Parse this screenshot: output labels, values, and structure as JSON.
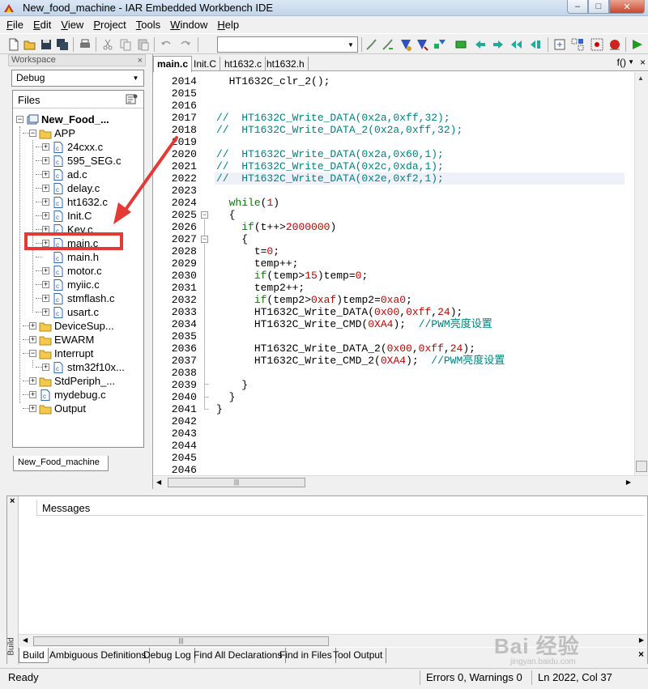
{
  "window": {
    "title": "New_food_machine - IAR Embedded Workbench IDE",
    "buttons": {
      "minimize": "–",
      "maximize": "□",
      "close": "✕"
    }
  },
  "menu": [
    "File",
    "Edit",
    "View",
    "Project",
    "Tools",
    "Window",
    "Help"
  ],
  "workspace": {
    "header": "Workspace",
    "close": "×",
    "config": "Debug",
    "files_label": "Files",
    "bottom_tab": "New_Food_machine",
    "tree": {
      "project": "New_Food_...",
      "app": "APP",
      "app_files": [
        "24cxx.c",
        "595_SEG.c",
        "ad.c",
        "delay.c",
        "ht1632.c",
        "Init.C",
        "Key.c",
        "main.c",
        "main.h",
        "motor.c",
        "myiic.c",
        "stmflash.c",
        "usart.c"
      ],
      "device": "DeviceSup...",
      "ewarm": "EWARM",
      "interrupt": "Interrupt",
      "interrupt_file": "stm32f10x...",
      "stdperiph": "StdPeriph_...",
      "mydebug": "mydebug.c",
      "output": "Output"
    }
  },
  "editor": {
    "tabs": [
      "main.c",
      "Init.C",
      "ht1632.c",
      "ht1632.h"
    ],
    "active_tab": "main.c",
    "func": "f()",
    "close": "×",
    "line_numbers": [
      "2014",
      "2015",
      "2016",
      "2017",
      "2018",
      "2019",
      "2020",
      "2021",
      "2022",
      "2023",
      "2024",
      "2025",
      "2026",
      "2027",
      "2028",
      "2029",
      "2030",
      "2031",
      "2032",
      "2033",
      "2034",
      "2035",
      "2036",
      "2037",
      "2038",
      "2039",
      "2040",
      "2041",
      "2042",
      "2043",
      "2044",
      "2045",
      "2046"
    ],
    "code": {
      "l2014": "  HT1632C_clr_2();",
      "l2017": "//  HT1632C_Write_DATA(0x2a,0xff,32);",
      "l2018": "//  HT1632C_Write_DATA_2(0x2a,0xff,32);",
      "l2020": "//  HT1632C_Write_DATA(0x2a,0x60,1);",
      "l2021": "//  HT1632C_Write_DATA(0x2c,0xda,1);",
      "l2022": "//  HT1632C_Write_DATA(0x2e,0xf2,1);",
      "l2024_kw": "while",
      "l2024_p1": "(",
      "l2024_num": "1",
      "l2024_p2": ")",
      "l2025": "  {",
      "l2026_kw": "if",
      "l2026_mid": "(t++>",
      "l2026_num": "2000000",
      "l2026_end": ")",
      "l2027": "    {",
      "l2028_a": "t=",
      "l2028_num": "0",
      "l2028_b": ";",
      "l2029": "temp++;",
      "l2030_kw": "if",
      "l2030_a": "(temp>",
      "l2030_num": "15",
      "l2030_b": ")temp=",
      "l2030_num2": "0",
      "l2030_c": ";",
      "l2031": "temp2++;",
      "l2032_kw": "if",
      "l2032_a": "(temp2>",
      "l2032_num": "0xaf",
      "l2032_b": ")temp2=",
      "l2032_num2": "0xa0",
      "l2032_c": ";",
      "l2033_a": "HT1632C_Write_DATA(",
      "l2033_n1": "0x00",
      "l2033_s1": ",",
      "l2033_n2": "0xff",
      "l2033_s2": ",",
      "l2033_n3": "24",
      "l2033_b": ");",
      "l2034_a": "HT1632C_Write_CMD(",
      "l2034_n1": "0XA4",
      "l2034_b": ");  ",
      "l2034_cmt": "//PWM亮度设置",
      "l2036_a": "HT1632C_Write_DATA_2(",
      "l2036_n1": "0x00",
      "l2036_s1": ",",
      "l2036_n2": "0xff",
      "l2036_s2": ",",
      "l2036_n3": "24",
      "l2036_b": ");",
      "l2037_a": "HT1632C_Write_CMD_2(",
      "l2037_n1": "0XA4",
      "l2037_b": ");  ",
      "l2037_cmt": "//PWM亮度设置",
      "l2039": "    }",
      "l2040": "  }",
      "l2041": "}"
    }
  },
  "build": {
    "close": "×",
    "side_label": "Build",
    "header": "Messages",
    "tabs": [
      "Build",
      "Ambiguous Definitions",
      "Debug Log",
      "Find All Declarations",
      "Find in Files",
      "Tool Output"
    ],
    "active_tab": "Build"
  },
  "status": {
    "ready": "Ready",
    "errors": "Errors 0, Warnings 0",
    "position": "Ln 2022, Col 37"
  },
  "watermark": {
    "text": "Bai 经验",
    "sub": "jingyan.baidu.com"
  },
  "colors": {
    "comment": "#008080",
    "keyword": "#008000",
    "number": "#c00000",
    "annotation": "#e53935"
  }
}
